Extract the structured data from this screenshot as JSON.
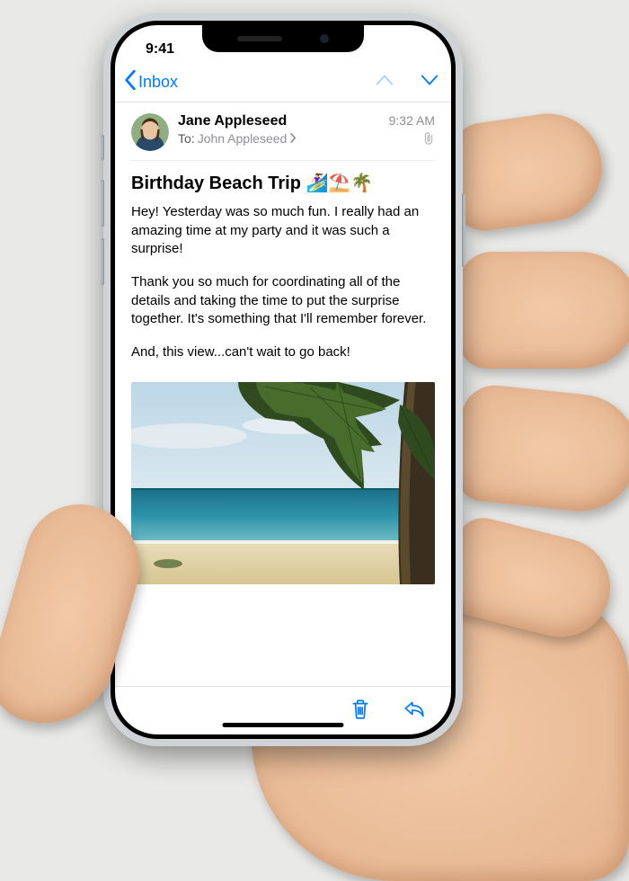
{
  "status": {
    "time": "9:41"
  },
  "nav": {
    "back_label": "Inbox"
  },
  "message": {
    "sender": "Jane Appleseed",
    "to_label": "To:",
    "recipient": "John Appleseed",
    "time": "9:32 AM",
    "subject": "Birthday Beach Trip 🏄‍♀️⛱️🌴",
    "body_p1": "Hey! Yesterday was so much fun. I really had an amazing time at my party and it was such a surprise!",
    "body_p2": "Thank you so much for coordinating all of the details and taking the time to put the surprise together. It's something that I'll remember forever.",
    "body_p3": "And, this view...can't wait to go back!"
  },
  "colors": {
    "accent": "#007aff"
  }
}
